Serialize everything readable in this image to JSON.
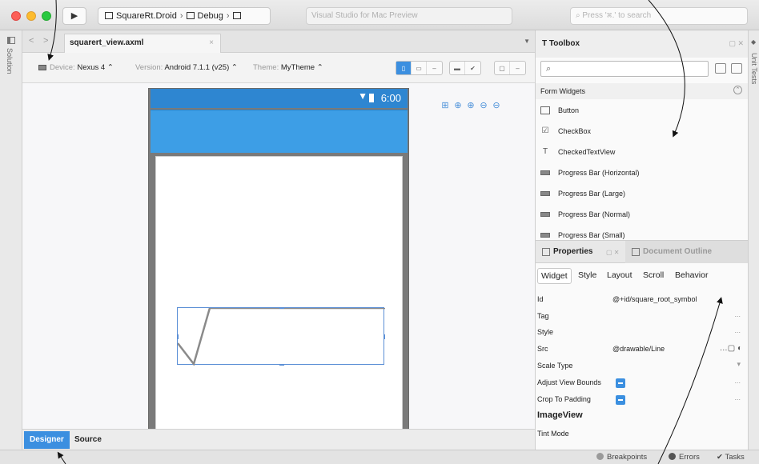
{
  "titlebar": {
    "config": [
      "SquareRt.Droid",
      "Debug",
      ""
    ],
    "status": "Visual Studio for Mac Preview",
    "search_placeholder": "Press '⌘.' to search",
    "run_glyph": "▶"
  },
  "left_pad": {
    "label": "Solution"
  },
  "editor": {
    "nav_back": "<",
    "nav_fwd": ">",
    "tab_name": "squarert_view.axml",
    "tab_close": "×",
    "device_label": "Device:",
    "device_value": "Nexus 4 ⌃",
    "version_label": "Version:",
    "version_value": "Android 7.1.1 (v25) ⌃",
    "theme_label": "Theme:",
    "theme_value": "MyTheme ⌃",
    "phone_time": "6:00",
    "bottom_tabs": [
      "Designer",
      "Source"
    ]
  },
  "toolbox": {
    "title": "Toolbox",
    "search_glyph": "🔍",
    "category": "Form Widgets",
    "items": [
      {
        "label": "Button",
        "icon": "button-icon"
      },
      {
        "label": "CheckBox",
        "icon": "checkbox-icon"
      },
      {
        "label": "CheckedTextView",
        "icon": "text-icon"
      },
      {
        "label": "Progress Bar (Horizontal)",
        "icon": "progressbar-icon"
      },
      {
        "label": "Progress Bar (Large)",
        "icon": "progressbar-icon"
      },
      {
        "label": "Progress Bar (Normal)",
        "icon": "progressbar-icon"
      },
      {
        "label": "Progress Bar (Small)",
        "icon": "progressbar-icon"
      }
    ]
  },
  "properties": {
    "title": "Properties",
    "outline_title": "Document Outline",
    "tabs": [
      "Widget",
      "Style",
      "Layout",
      "Scroll",
      "Behavior"
    ],
    "rows": [
      {
        "key": "Id",
        "value": "@+id/square_root_symbol"
      },
      {
        "key": "Tag",
        "value": ""
      },
      {
        "key": "Style",
        "value": ""
      },
      {
        "key": "Src",
        "value": "@drawable/Line"
      },
      {
        "key": "Scale Type",
        "value": ""
      },
      {
        "key": "Adjust View Bounds",
        "value": ""
      },
      {
        "key": "Crop To Padding",
        "value": ""
      }
    ],
    "group": "ImageView",
    "tint_mode": "Tint Mode",
    "more": "..."
  },
  "right_pad": {
    "label": "Unit Tests"
  },
  "statusbar": {
    "breakpoints": "Breakpoints",
    "errors": "Errors",
    "tasks": "Tasks"
  },
  "colors": {
    "accent": "#3b8fe0",
    "android_primary": "#2e86d1"
  }
}
